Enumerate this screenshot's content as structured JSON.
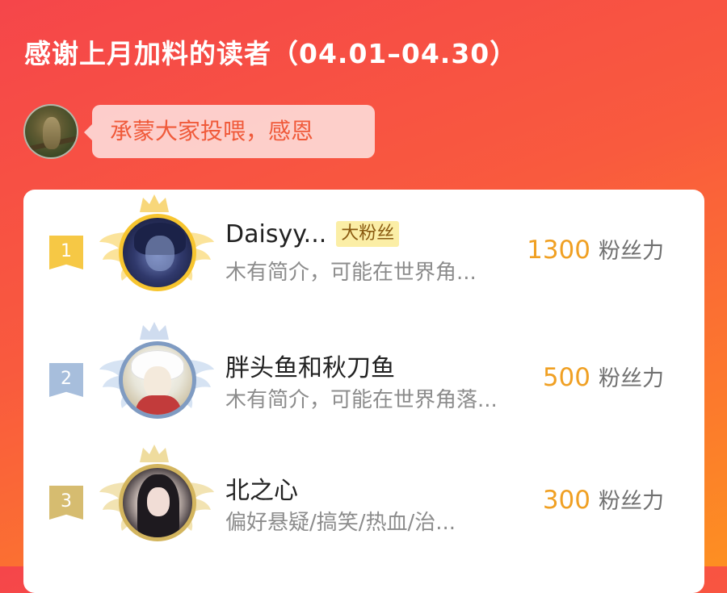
{
  "header": {
    "title": "感谢上月加料的读者（04.01–04.30）"
  },
  "author": {
    "avatar_icon": "owl-avatar",
    "message": "承蒙大家投喂，感恩"
  },
  "colors": {
    "gold": "#f6c845",
    "silver": "#a7bedc",
    "bronze": "#d6bc70",
    "score": "#f0a023"
  },
  "readers": [
    {
      "rank": "1",
      "name": "Daisyy...",
      "badge": "大粉丝",
      "intro": "木有简介，可能在世界角...",
      "score": "1300",
      "unit": "粉丝力"
    },
    {
      "rank": "2",
      "name": "胖头鱼和秋刀鱼",
      "badge": "",
      "intro": "木有简介，可能在世界角落...",
      "score": "500",
      "unit": "粉丝力"
    },
    {
      "rank": "3",
      "name": "北之心",
      "badge": "",
      "intro": "偏好悬疑/搞笑/热血/治...",
      "score": "300",
      "unit": "粉丝力"
    }
  ]
}
